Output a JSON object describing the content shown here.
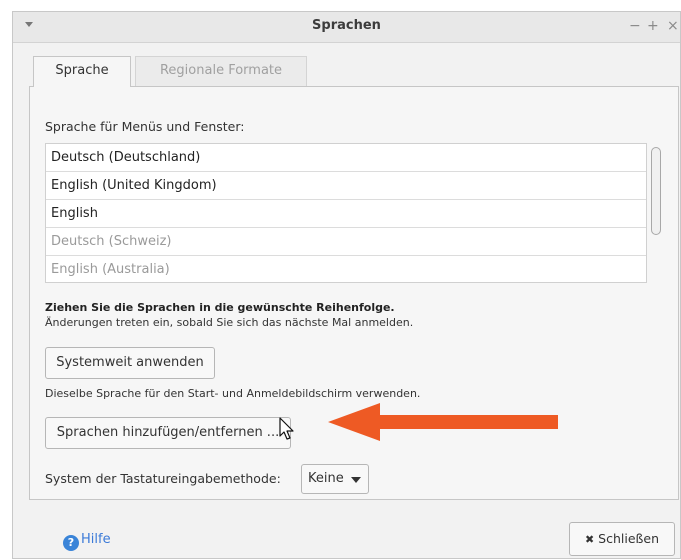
{
  "window": {
    "title": "Sprachen",
    "minimize": "−",
    "maximize": "+",
    "close": "×"
  },
  "tabs": [
    {
      "label": "Sprache"
    },
    {
      "label": "Regionale Formate"
    }
  ],
  "section_label": "Sprache für Menüs und Fenster:",
  "languages": [
    {
      "label": "Deutsch (Deutschland)"
    },
    {
      "label": "English (United Kingdom)"
    },
    {
      "label": "English"
    },
    {
      "label": "Deutsch (Schweiz)"
    },
    {
      "label": "English (Australia)"
    }
  ],
  "note_bold": "Ziehen Sie die Sprachen in die gewünschte Reihenfolge.",
  "note_small": "Änderungen treten ein, sobald Sie sich das nächste Mal anmelden.",
  "apply_button": "Systemweit anwenden",
  "apply_note": "Dieselbe Sprache für den Start- und Anmeldebildschirm verwenden.",
  "add_remove_button": "Sprachen hinzufügen/entfernen ...",
  "input_method": {
    "label": "System der Tastatureingabemethode:",
    "value": "Keine"
  },
  "help": {
    "label": "Hilfe",
    "icon": "?"
  },
  "close_button": {
    "label": "Schließen",
    "icon": "✖"
  },
  "colors": {
    "annotation_arrow": "#ee5a24",
    "help_link": "#3b7ad8"
  }
}
